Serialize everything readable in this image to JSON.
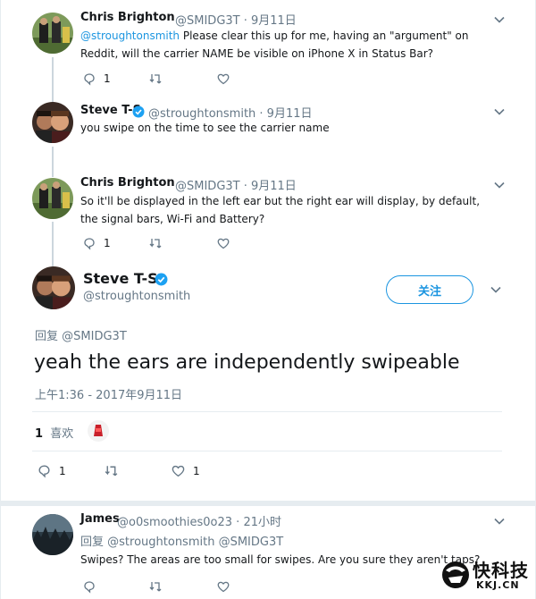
{
  "tweets": [
    {
      "name": "Chris Brighton",
      "handle_line": "@SMIDG3T · 9月11日",
      "mention": "@stroughtonsmith",
      "text": " Please clear this up for me, having an \"argument\" on Reddit, will the carrier NAME be visible on iPhone X in Status Bar?",
      "reply_count": "1"
    },
    {
      "name": "Steve T-S",
      "handle_line": "@stroughtonsmith · 9月11日",
      "text": "you swipe on the time to see the carrier name"
    },
    {
      "name": "Chris Brighton",
      "handle_line": "@SMIDG3T · 9月11日",
      "text": "So it'll be displayed in the left ear but the right ear will display, by default, the signal bars, Wi-Fi and Battery?",
      "reply_count": "1"
    }
  ],
  "main_tweet": {
    "name": "Steve T-S",
    "handle": "@stroughtonsmith",
    "follow_label": "关注",
    "reply_to_prefix": "回复",
    "reply_to": "@SMIDG3T",
    "text": "yeah the ears are independently swipeable",
    "timestamp": "上午1:36 - 2017年9月11日",
    "likes_count": "1",
    "likes_label": "喜欢",
    "reply_count": "1",
    "like_count": "1"
  },
  "reply": {
    "name": "James",
    "handle_line": "@o0smoothies0o23 · 21小时",
    "reply_to_prefix": "回复",
    "reply_to_1": "@stroughtonsmith",
    "reply_to_2": "@SMIDG3T",
    "text": "Swipes? The areas are too small for swipes. Are you sure they aren't taps?"
  },
  "watermark": {
    "title": "快科技",
    "sub": "KKJ.CN"
  },
  "colors": {
    "accent": "#1b95e0",
    "muted": "#657786",
    "divider": "#e6ecf0",
    "thread": "#ccd6dd"
  }
}
